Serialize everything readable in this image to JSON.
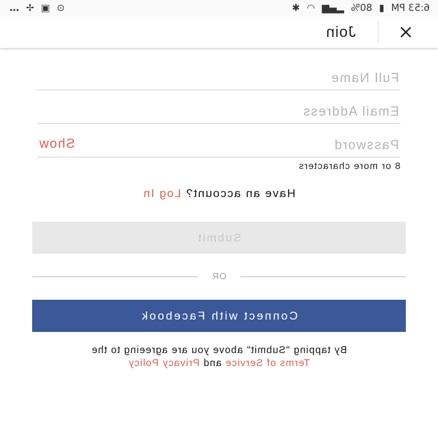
{
  "status_bar": {
    "time": "6:53 PM",
    "battery": "80%",
    "dots": "…"
  },
  "header": {
    "title": "Join",
    "close_symbol": "✕"
  },
  "form": {
    "full_name_placeholder": "Full Name",
    "email_placeholder": "Email Address",
    "password_placeholder": "Password",
    "show_label": "Show",
    "password_hint": "8 or more characters"
  },
  "login_prompt": {
    "text": "Have an account?",
    "link": "Log In"
  },
  "submit_label": "Submit",
  "or_label": "OR",
  "facebook_label": "Connect with Facebook",
  "terms": {
    "line1": "By tapping \"Submit\" above you are agreeing to the",
    "terms_link": "Terms of Service",
    "and": "and",
    "privacy_link": "Privacy Policy"
  },
  "colors": {
    "accent": "#e35d4f",
    "facebook": "#3b5898",
    "submit_disabled_bg": "#e8e8e8"
  }
}
